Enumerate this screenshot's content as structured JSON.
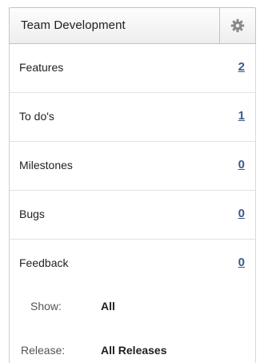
{
  "header": {
    "title": "Team Development",
    "gear_icon": "gear-icon"
  },
  "rows": [
    {
      "label": "Features",
      "count": "2"
    },
    {
      "label": "To do's",
      "count": "1"
    },
    {
      "label": "Milestones",
      "count": "0"
    },
    {
      "label": "Bugs",
      "count": "0"
    },
    {
      "label": "Feedback",
      "count": "0"
    }
  ],
  "filters": {
    "show": {
      "label": "Show:",
      "value": "All"
    },
    "release": {
      "label": "Release:",
      "value": "All Releases"
    }
  },
  "colors": {
    "link": "#3d5a8a",
    "header_bg": "#eeeeee",
    "border": "#c4c4c4"
  }
}
